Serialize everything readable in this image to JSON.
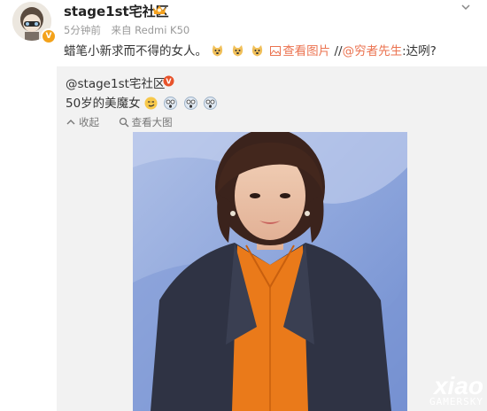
{
  "post": {
    "username": "stage1st宅社区",
    "meta_time": "5分钟前",
    "meta_source": "来自 Redmi K50",
    "text_intro": "蜡笔小新求而不得的女人。",
    "view_image_label": "查看图片",
    "separator": " //",
    "mention": "@穷者先生",
    "text_tail": ":达咧?"
  },
  "repost": {
    "username": "@stage1st宅社区",
    "text": "50岁的美魔女",
    "actions": {
      "collapse": "收起",
      "view_large": "查看大图"
    }
  },
  "watermark": {
    "logo": "xiao",
    "site": "GAMERSKY"
  },
  "colors": {
    "link": "#eb7350",
    "repost_bg": "#f2f2f2",
    "verified": "#f3a21b"
  }
}
